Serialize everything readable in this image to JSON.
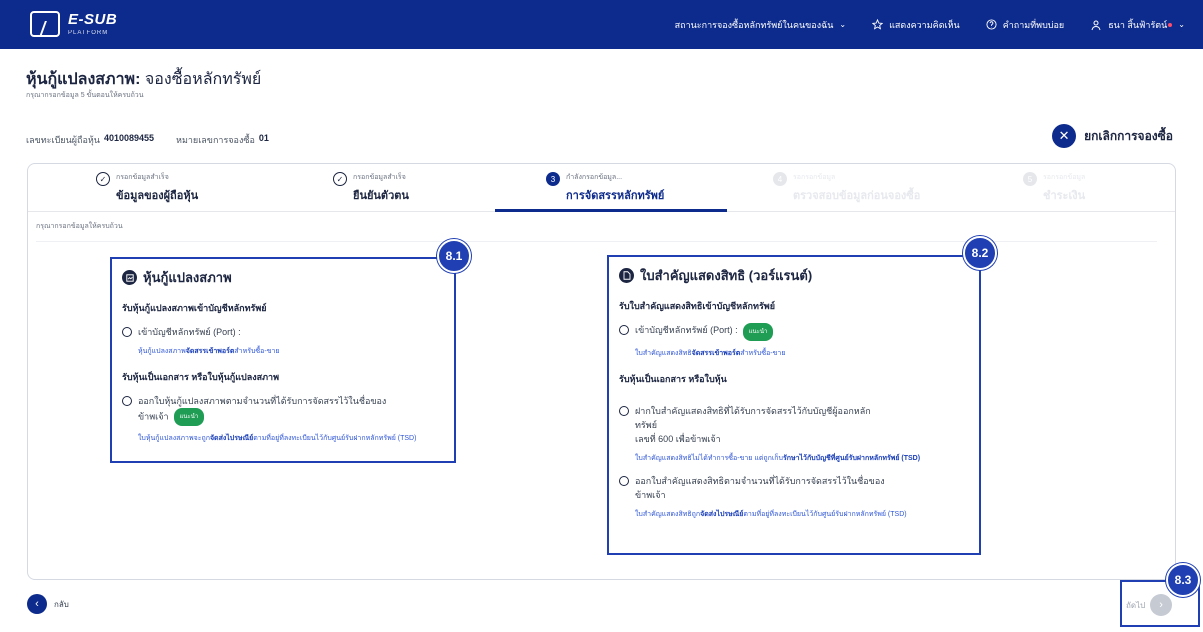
{
  "brand": {
    "name": "E-SUB",
    "sub": "PLATFORM"
  },
  "topnav": {
    "dropdown_label": "สถานะการจองซื้อหลักทรัพย์ในคนของฉัน",
    "favorite_label": "แสดงความคิดเห็น",
    "help_label": "คำถามที่พบบ่อย",
    "user_label": "ธนา สิ้นฟ้ารัตน์"
  },
  "header": {
    "title": "หุ้นกู้แปลงสภาพ:",
    "title_sub": "จองซื้อหลักทรัพย์",
    "subtitle": "กรุณากรอกข้อมูล 5 ขั้นตอนให้ครบถ้วน"
  },
  "info": {
    "holder_label": "เลขทะเบียนผู้ถือหุ้น",
    "holder_value": "4010089455",
    "order_label": "หมายเลขการจองซื้อ",
    "order_value": "01"
  },
  "cancel_label": "ยกเลิกการจองซื้อ",
  "steps": [
    {
      "top": "กรอกข้อมูลสำเร็จ",
      "label": "ข้อมูลของผู้ถือหุ้น",
      "icon": "✓"
    },
    {
      "top": "กรอกข้อมูลสำเร็จ",
      "label": "ยืนยันตัวตน",
      "icon": "✓"
    },
    {
      "top": "กำลังกรอกข้อมูล...",
      "label": "การจัดสรรหลักทรัพย์",
      "icon": "3"
    },
    {
      "top": "รอกรอกข้อมูล",
      "label": "ตรวจสอบข้อมูลก่อนจองซื้อ",
      "icon": "4"
    },
    {
      "top": "รอกรอกข้อมูล",
      "label": "ชำระเงิน",
      "icon": "5"
    }
  ],
  "hint": "กรุณากรอกข้อมูลให้ครบถ้วน",
  "panel_left": {
    "marker": "8.1",
    "title": "หุ้นกู้แปลงสภาพ",
    "section1": "รับหุ้นกู้แปลงสภาพเข้าบัญชีหลักทรัพย์",
    "opt1": "เข้าบัญชีหลักทรัพย์ (Port) :",
    "note1_a": "หุ้นกู้แปลงสภาพ",
    "note1_b": "จัดสรรเข้าพอร์ต",
    "note1_c": "สำหรับซื้อ-ขาย",
    "section2": "รับหุ้นเป็นเอกสาร หรือใบหุ้นกู้แปลงสภาพ",
    "opt2_line1": "ออกใบหุ้นกู้แปลงสภาพตามจำนวนที่ได้รับการจัดสรรไว้ในชื่อของ",
    "opt2_line2": "ข้าพเจ้า",
    "badge": "แนะนำ",
    "note2_a": "ใบหุ้นกู้แปลงสภาพจะถูก",
    "note2_b": "จัดส่งไปรษณีย์",
    "note2_c": "ตามที่อยู่ที่ลงทะเบียนไว้กับศูนย์รับฝากหลักทรัพย์ (TSD)"
  },
  "panel_right": {
    "marker": "8.2",
    "title": "ใบสำคัญแสดงสิทธิ (วอร์แรนต์)",
    "section1": "รับใบสำคัญแสดงสิทธิเข้าบัญชีหลักทรัพย์",
    "opt1": "เข้าบัญชีหลักทรัพย์ (Port) :",
    "badge": "แนะนำ",
    "note1_a": "ใบสำคัญแสดงสิทธิ",
    "note1_b": "จัดสรรเข้าพอร์ต",
    "note1_c": "สำหรับซื้อ-ขาย",
    "section2": "รับหุ้นเป็นเอกสาร หรือใบหุ้น",
    "opt2_line1": "ฝากใบสำคัญแสดงสิทธิที่ได้รับการจัดสรรไว้กับบัญชีผู้ออกหลัก",
    "opt2_line2": "ทรัพย์",
    "opt2_line3": "เลขที่ 600 เพื่อข้าพเจ้า",
    "note2_a": "ใบสำคัญแสดงสิทธิไม่ได้ทำการซื้อ-ขาย แต่ถูกเก็บ",
    "note2_b": "รักษาไว้กับบัญชีที่ศูนย์รับฝากหลักทรัพย์ (TSD)",
    "opt3_line1": "ออกใบสำคัญแสดงสิทธิตามจำนวนที่ได้รับการจัดสรรไว้ในชื่อของ",
    "opt3_line2": "ข้าพเจ้า",
    "note3_a": "ใบสำคัญแสดงสิทธิถูก",
    "note3_b": "จัดส่งไปรษณีย์",
    "note3_c": "ตามที่อยู่ที่ลงทะเบียนไว้กับศูนย์รับฝากหลักทรัพย์ (TSD)"
  },
  "footer": {
    "back_label": "กลับ",
    "next_label": "ถัดไป",
    "next_marker": "8.3"
  }
}
